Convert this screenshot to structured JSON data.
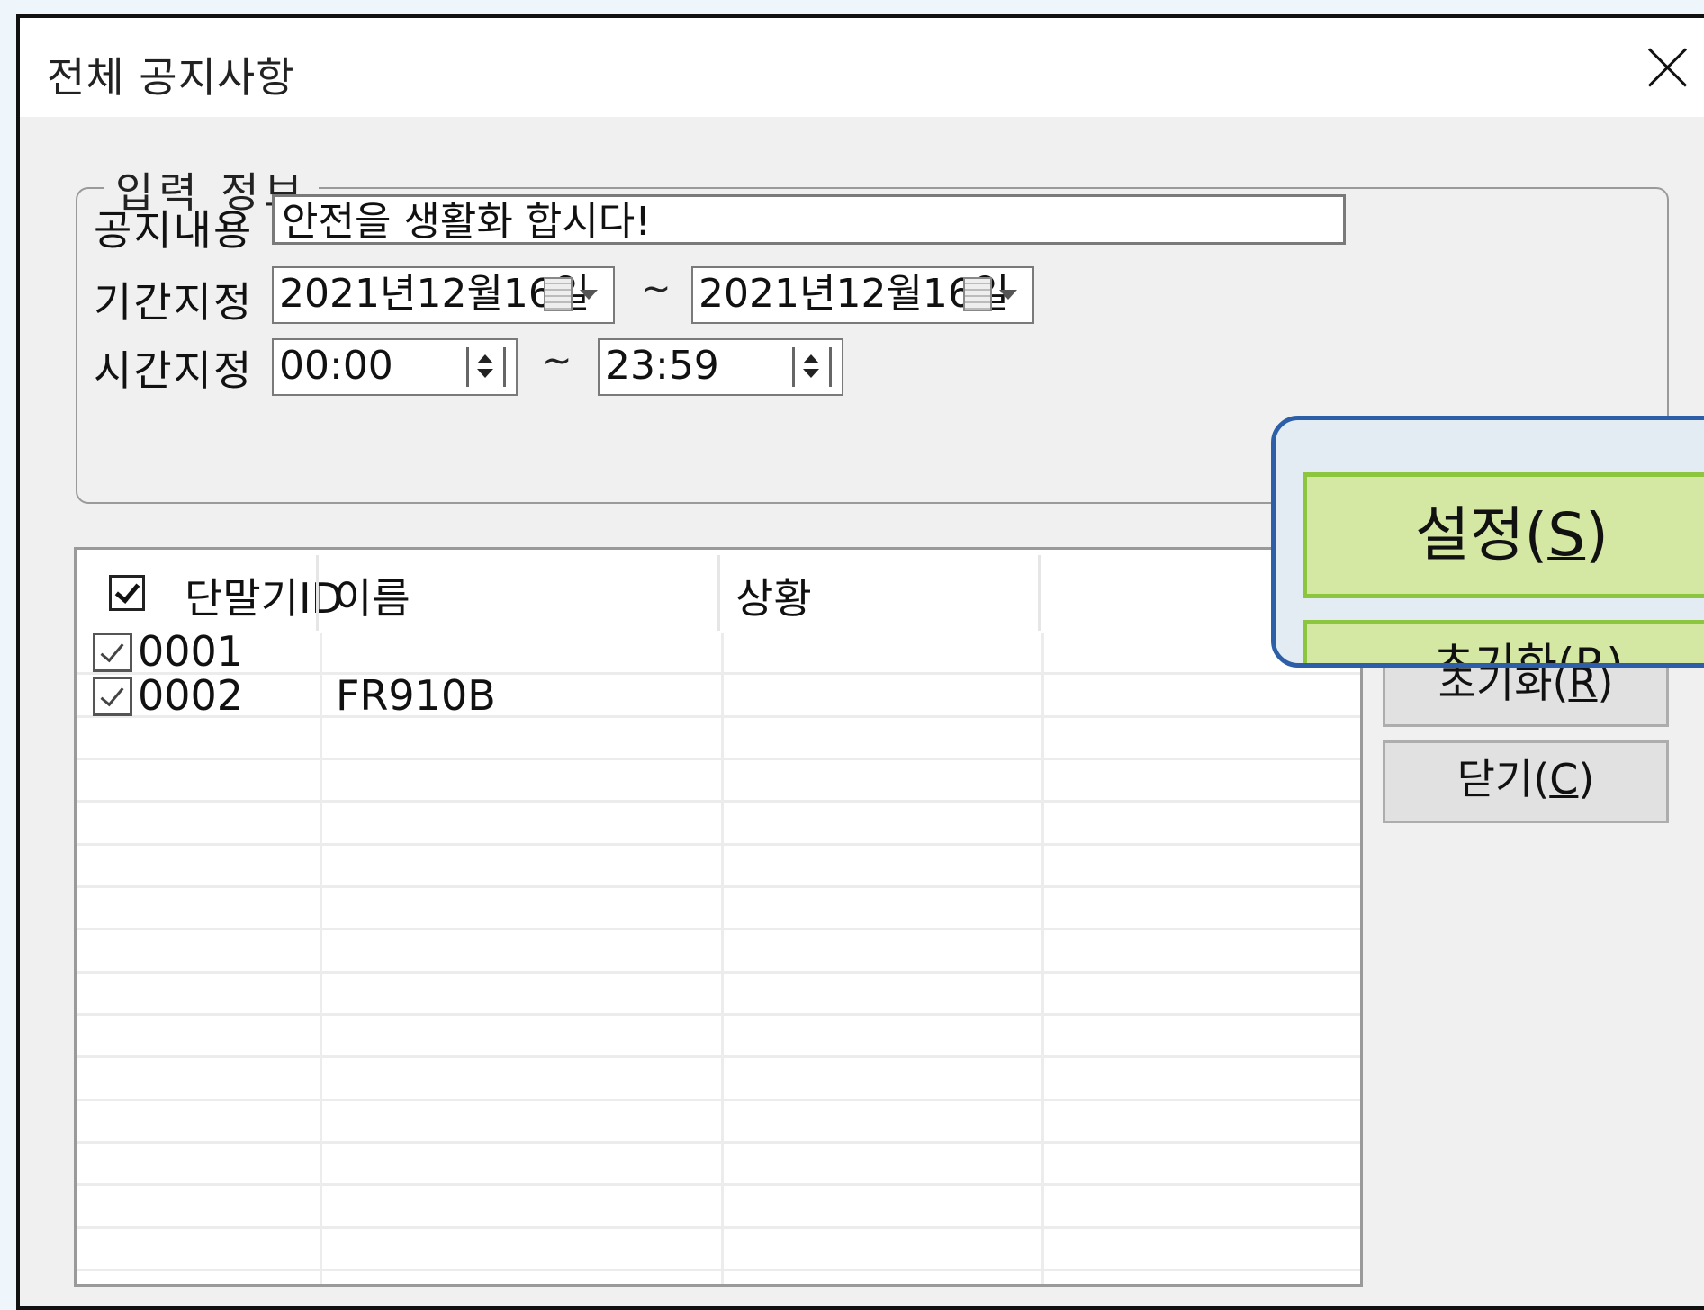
{
  "window": {
    "title": "전체 공지사항"
  },
  "input_group": {
    "legend": "입력 정보",
    "notice_label": "공지내용",
    "notice_value": "안전을 생활화 합시다!",
    "period_label": "기간지정",
    "date_from": "2021년12월16일",
    "date_to": "2021년12월16일",
    "time_label": "시간지정",
    "time_from": "00:00",
    "time_to": "23:59",
    "tilde": "~"
  },
  "grid": {
    "columns": [
      "단말기ID",
      "이름",
      "상황"
    ],
    "header_checked": true,
    "rows": [
      {
        "id": "0001",
        "name": "",
        "status": "",
        "checked": true
      },
      {
        "id": "0002",
        "name": "FR910B",
        "status": "",
        "checked": true
      }
    ]
  },
  "buttons": {
    "set_text": "설정(",
    "set_key": "S",
    "set_close": ")",
    "init_text": "초기화(",
    "init_key": "R",
    "init_close": ")",
    "close_text": "닫기(",
    "close_key": "C",
    "close_close": ")"
  },
  "icons": [
    "close-icon",
    "calendar-icon",
    "dropdown-arrow-icon",
    "spin-up-icon",
    "spin-down-icon",
    "checkbox-icon"
  ]
}
